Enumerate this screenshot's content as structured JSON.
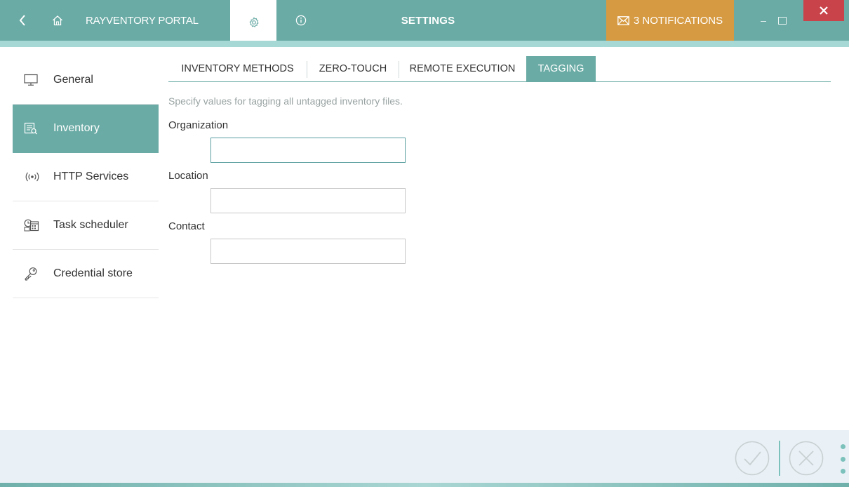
{
  "titlebar": {
    "portal_label": "RAYVENTORY PORTAL",
    "title": "SETTINGS",
    "notifications_label": "3 NOTIFICATIONS",
    "min_symbol": "–"
  },
  "sidebar": {
    "items": [
      {
        "label": "General",
        "icon": "monitor-icon"
      },
      {
        "label": "Inventory",
        "icon": "inventory-icon"
      },
      {
        "label": "HTTP Services",
        "icon": "broadcast-icon"
      },
      {
        "label": "Task scheduler",
        "icon": "calendar-clock-icon"
      },
      {
        "label": "Credential store",
        "icon": "key-icon"
      }
    ],
    "active_index": 1
  },
  "tabs": {
    "items": [
      {
        "label": "INVENTORY METHODS"
      },
      {
        "label": "ZERO-TOUCH"
      },
      {
        "label": "REMOTE EXECUTION"
      },
      {
        "label": "TAGGING"
      }
    ],
    "active_index": 3
  },
  "form": {
    "description": "Specify values for tagging all untagged inventory files.",
    "organization": {
      "label": "Organization",
      "value": ""
    },
    "location": {
      "label": "Location",
      "value": ""
    },
    "contact": {
      "label": "Contact",
      "value": ""
    }
  },
  "colors": {
    "accent": "#6aaba5",
    "accent_light": "#a6d8d6",
    "notification": "#d69a42",
    "close": "#c9434a",
    "footer_bg": "#e9f1f6"
  }
}
